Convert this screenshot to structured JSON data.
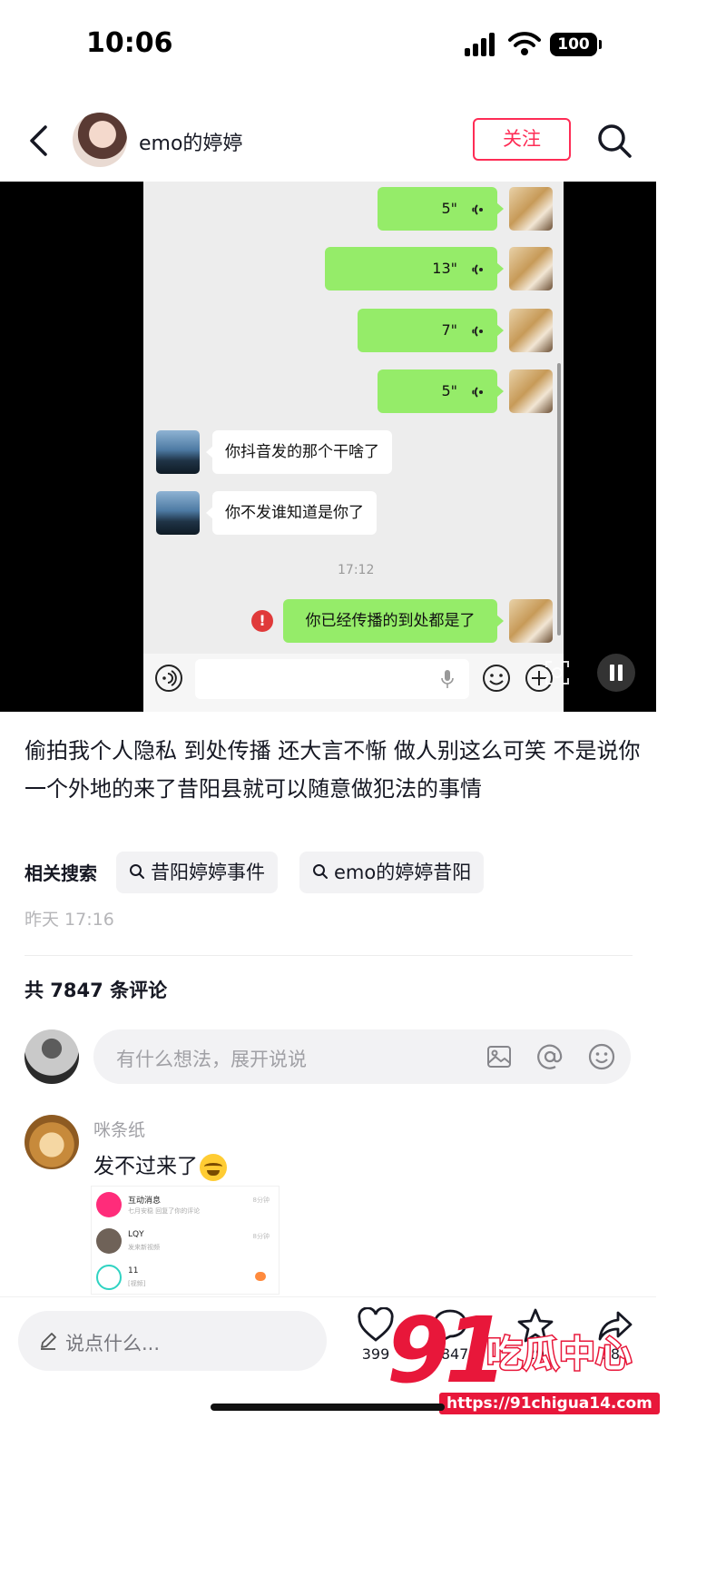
{
  "status_bar": {
    "time": "10:06",
    "battery": "100"
  },
  "header": {
    "author_name": "emo的婷婷",
    "follow_label": "关注"
  },
  "chat": {
    "voice_messages": [
      "5\"",
      "13\"",
      "7\"",
      "5\""
    ],
    "incoming_messages": [
      "你抖音发的那个干啥了",
      "你不发谁知道是你了"
    ],
    "time_divider": "17:12",
    "failed_message": "你已经传播的到处都是了",
    "error_mark": "!"
  },
  "description": "偷拍我个人隐私 到处传播 还大言不惭 做人别这么可笑 不是说你一个外地的来了昔阳县就可以随意做犯法的事情",
  "related_search": {
    "label": "相关搜索",
    "chips": [
      "昔阳婷婷事件",
      "emo的婷婷昔阳"
    ]
  },
  "post_time": "昨天 17:16",
  "comments": {
    "count_label": "共 7847 条评论",
    "input_placeholder": "有什么想法，展开说说",
    "items": [
      {
        "author": "咪条纸",
        "text": "发不过来了",
        "image_rows": [
          {
            "title": "互动消息",
            "sub": "七月安稳 回复了你的评论",
            "tag": "8分钟"
          },
          {
            "title": "LQY",
            "sub": "发来新视频",
            "tag": "8分钟"
          },
          {
            "title": "11",
            "sub": "[视频]",
            "tag": ""
          }
        ]
      }
    ]
  },
  "bottom_bar": {
    "say_placeholder": "说点什么...",
    "like_count": "399",
    "comment_count": "7847",
    "fav_count": "29",
    "share_count": "383"
  },
  "watermark": {
    "number": "91",
    "text": "吃瓜中心",
    "url": "https://91chigua14.com"
  },
  "colors": {
    "accent": "#fe2c55",
    "wechat_green": "#95ec69",
    "watermark_red": "#e8173a"
  }
}
